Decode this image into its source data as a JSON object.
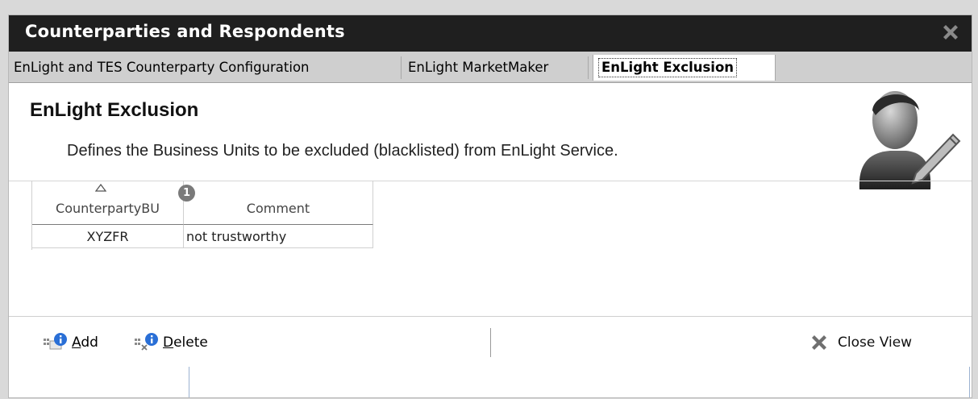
{
  "window": {
    "title": "Counterparties and Respondents"
  },
  "tabs": [
    {
      "label": "EnLight and TES Counterparty Configuration"
    },
    {
      "label": "EnLight MarketMaker"
    },
    {
      "label": "EnLight Exclusion"
    }
  ],
  "section": {
    "heading": "EnLight Exclusion",
    "description": "Defines the Business Units to be excluded (blacklisted) from EnLight Service."
  },
  "grid": {
    "columns": [
      "CounterpartyBU",
      "Comment"
    ],
    "sort_badge": "1",
    "rows": [
      {
        "bu": "XYZFR",
        "comment": "not trustworthy"
      }
    ]
  },
  "toolbar": {
    "add_label": "Add",
    "delete_label": "Delete",
    "close_view_label": "Close View"
  },
  "colors": {
    "titlebar_bg": "#1f1f1f",
    "tabbar_bg": "#cfcfcf",
    "accent_blue": "#2a6fd6"
  }
}
